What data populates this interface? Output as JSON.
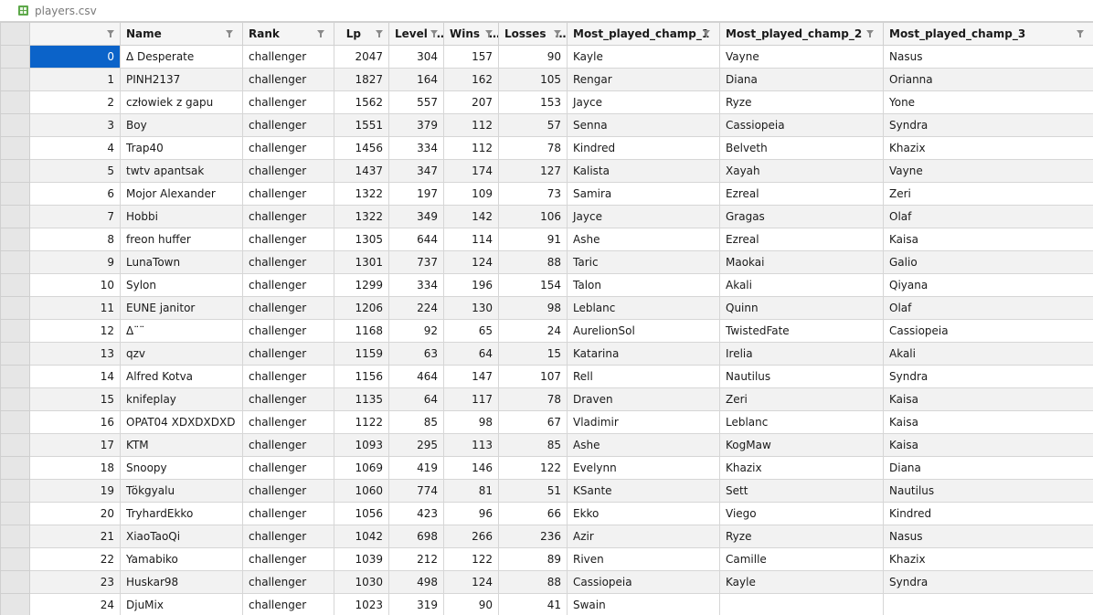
{
  "file": {
    "name": "players.csv"
  },
  "columns": [
    {
      "key": "index",
      "label": ""
    },
    {
      "key": "name",
      "label": "Name"
    },
    {
      "key": "rank",
      "label": "Rank"
    },
    {
      "key": "lp",
      "label": "Lp"
    },
    {
      "key": "level",
      "label": "Level"
    },
    {
      "key": "wins",
      "label": "Wins"
    },
    {
      "key": "losses",
      "label": "Losses"
    },
    {
      "key": "m1",
      "label": "Most_played_champ_1"
    },
    {
      "key": "m2",
      "label": "Most_played_champ_2"
    },
    {
      "key": "m3",
      "label": "Most_played_champ_3"
    }
  ],
  "rows": [
    {
      "index": "0",
      "name": "Δ Desperate",
      "rank": "challenger",
      "lp": "2047",
      "level": "304",
      "wins": "157",
      "losses": "90",
      "m1": "Kayle",
      "m2": "Vayne",
      "m3": "Nasus"
    },
    {
      "index": "1",
      "name": "PINH2137",
      "rank": "challenger",
      "lp": "1827",
      "level": "164",
      "wins": "162",
      "losses": "105",
      "m1": "Rengar",
      "m2": "Diana",
      "m3": "Orianna"
    },
    {
      "index": "2",
      "name": "człowiek z gapu",
      "rank": "challenger",
      "lp": "1562",
      "level": "557",
      "wins": "207",
      "losses": "153",
      "m1": "Jayce",
      "m2": "Ryze",
      "m3": "Yone"
    },
    {
      "index": "3",
      "name": "Boy",
      "rank": "challenger",
      "lp": "1551",
      "level": "379",
      "wins": "112",
      "losses": "57",
      "m1": "Senna",
      "m2": "Cassiopeia",
      "m3": "Syndra"
    },
    {
      "index": "4",
      "name": "Trap40",
      "rank": "challenger",
      "lp": "1456",
      "level": "334",
      "wins": "112",
      "losses": "78",
      "m1": "Kindred",
      "m2": "Belveth",
      "m3": "Khazix"
    },
    {
      "index": "5",
      "name": "twtv apantsak",
      "rank": "challenger",
      "lp": "1437",
      "level": "347",
      "wins": "174",
      "losses": "127",
      "m1": "Kalista",
      "m2": "Xayah",
      "m3": "Vayne"
    },
    {
      "index": "6",
      "name": "Mojor Alexander",
      "rank": "challenger",
      "lp": "1322",
      "level": "197",
      "wins": "109",
      "losses": "73",
      "m1": "Samira",
      "m2": "Ezreal",
      "m3": "Zeri"
    },
    {
      "index": "7",
      "name": "Hobbi",
      "rank": "challenger",
      "lp": "1322",
      "level": "349",
      "wins": "142",
      "losses": "106",
      "m1": "Jayce",
      "m2": "Gragas",
      "m3": "Olaf"
    },
    {
      "index": "8",
      "name": "freon huffer",
      "rank": "challenger",
      "lp": "1305",
      "level": "644",
      "wins": "114",
      "losses": "91",
      "m1": "Ashe",
      "m2": "Ezreal",
      "m3": "Kaisa"
    },
    {
      "index": "9",
      "name": "LunaTown",
      "rank": "challenger",
      "lp": "1301",
      "level": "737",
      "wins": "124",
      "losses": "88",
      "m1": "Taric",
      "m2": "Maokai",
      "m3": "Galio"
    },
    {
      "index": "10",
      "name": "Sylon",
      "rank": "challenger",
      "lp": "1299",
      "level": "334",
      "wins": "196",
      "losses": "154",
      "m1": "Talon",
      "m2": "Akali",
      "m3": "Qiyana"
    },
    {
      "index": "11",
      "name": "EUNE janitor",
      "rank": "challenger",
      "lp": "1206",
      "level": "224",
      "wins": "130",
      "losses": "98",
      "m1": "Leblanc",
      "m2": "Quinn",
      "m3": "Olaf"
    },
    {
      "index": "12",
      "name": "Δ¨¨",
      "rank": "challenger",
      "lp": "1168",
      "level": "92",
      "wins": "65",
      "losses": "24",
      "m1": "AurelionSol",
      "m2": "TwistedFate",
      "m3": "Cassiopeia"
    },
    {
      "index": "13",
      "name": "qzv",
      "rank": "challenger",
      "lp": "1159",
      "level": "63",
      "wins": "64",
      "losses": "15",
      "m1": "Katarina",
      "m2": "Irelia",
      "m3": "Akali"
    },
    {
      "index": "14",
      "name": "Alfred Kotva",
      "rank": "challenger",
      "lp": "1156",
      "level": "464",
      "wins": "147",
      "losses": "107",
      "m1": "Rell",
      "m2": "Nautilus",
      "m3": "Syndra"
    },
    {
      "index": "15",
      "name": "knifeplay",
      "rank": "challenger",
      "lp": "1135",
      "level": "64",
      "wins": "117",
      "losses": "78",
      "m1": "Draven",
      "m2": "Zeri",
      "m3": "Kaisa"
    },
    {
      "index": "16",
      "name": "OPAT04 XDXDXDXD",
      "rank": "challenger",
      "lp": "1122",
      "level": "85",
      "wins": "98",
      "losses": "67",
      "m1": "Vladimir",
      "m2": "Leblanc",
      "m3": "Kaisa"
    },
    {
      "index": "17",
      "name": "KTM",
      "rank": "challenger",
      "lp": "1093",
      "level": "295",
      "wins": "113",
      "losses": "85",
      "m1": "Ashe",
      "m2": "KogMaw",
      "m3": "Kaisa"
    },
    {
      "index": "18",
      "name": "Snoopy",
      "rank": "challenger",
      "lp": "1069",
      "level": "419",
      "wins": "146",
      "losses": "122",
      "m1": "Evelynn",
      "m2": "Khazix",
      "m3": "Diana"
    },
    {
      "index": "19",
      "name": "Tökgyalu",
      "rank": "challenger",
      "lp": "1060",
      "level": "774",
      "wins": "81",
      "losses": "51",
      "m1": "KSante",
      "m2": "Sett",
      "m3": "Nautilus"
    },
    {
      "index": "20",
      "name": "TryhardEkko",
      "rank": "challenger",
      "lp": "1056",
      "level": "423",
      "wins": "96",
      "losses": "66",
      "m1": "Ekko",
      "m2": "Viego",
      "m3": "Kindred"
    },
    {
      "index": "21",
      "name": "XiaoTaoQi",
      "rank": "challenger",
      "lp": "1042",
      "level": "698",
      "wins": "266",
      "losses": "236",
      "m1": "Azir",
      "m2": "Ryze",
      "m3": "Nasus"
    },
    {
      "index": "22",
      "name": "Yamabiko",
      "rank": "challenger",
      "lp": "1039",
      "level": "212",
      "wins": "122",
      "losses": "89",
      "m1": "Riven",
      "m2": "Camille",
      "m3": "Khazix"
    },
    {
      "index": "23",
      "name": "Huskar98",
      "rank": "challenger",
      "lp": "1030",
      "level": "498",
      "wins": "124",
      "losses": "88",
      "m1": "Cassiopeia",
      "m2": "Kayle",
      "m3": "Syndra"
    },
    {
      "index": "24",
      "name": "DjuMix",
      "rank": "challenger",
      "lp": "1023",
      "level": "319",
      "wins": "90",
      "losses": "41",
      "m1": "Swain",
      "m2": "",
      "m3": ""
    }
  ],
  "colors": {
    "selection": "#0b63c9",
    "header_bg": "#f5f5f5",
    "row_alt": "#f2f2f2",
    "file_icon": "#5da84a"
  },
  "selected_cell": {
    "row": 0,
    "column": "index"
  }
}
